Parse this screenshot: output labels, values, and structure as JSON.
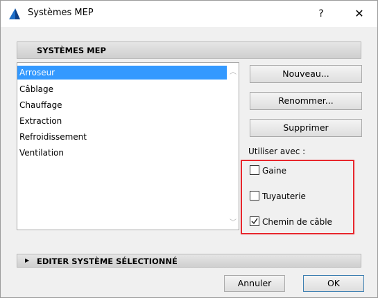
{
  "window": {
    "title": "Systèmes MEP",
    "help": "?",
    "close": "✕"
  },
  "section": {
    "title": "SYSTÈMES MEP"
  },
  "list": {
    "items": [
      "Arroseur",
      "Câblage",
      "Chauffage",
      "Extraction",
      "Refroidissement",
      "Ventilation"
    ],
    "selected_index": 0
  },
  "actions": {
    "new": "Nouveau...",
    "rename": "Renommer...",
    "delete": "Supprimer"
  },
  "use_with": {
    "label": "Utiliser avec :",
    "options": [
      {
        "label": "Gaine",
        "checked": false
      },
      {
        "label": "Tuyauterie",
        "checked": false
      },
      {
        "label": "Chemin de câble",
        "checked": true
      }
    ]
  },
  "edit_section": {
    "title": "EDITER SYSTÈME SÉLECTIONNÉ"
  },
  "footer": {
    "cancel": "Annuler",
    "ok": "OK"
  },
  "colors": {
    "selection": "#3399ff",
    "highlight_box": "#e8262c"
  },
  "icons": {
    "app": "archicad-app-icon",
    "expand": "triangle-right-icon",
    "scroll_up": "chevron-up-icon",
    "scroll_down": "chevron-down-icon"
  }
}
